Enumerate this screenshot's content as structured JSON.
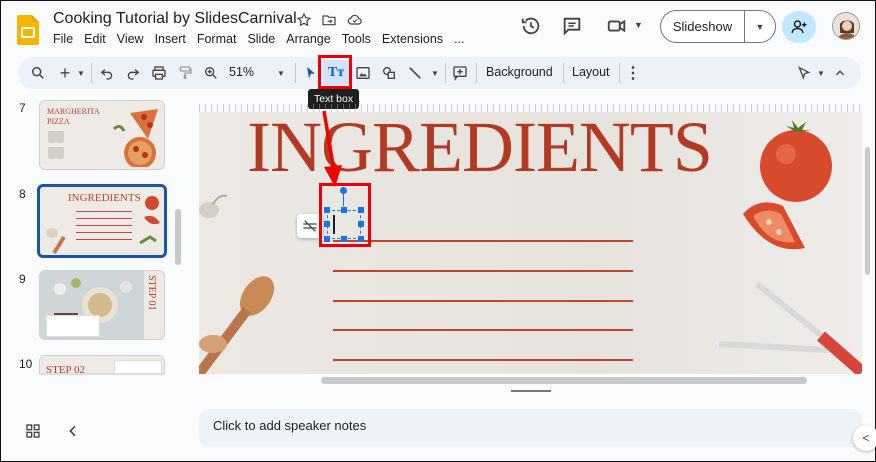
{
  "app": {
    "title": "Cooking Tutorial by SlidesCarnival",
    "menu": [
      "File",
      "Edit",
      "View",
      "Insert",
      "Format",
      "Slide",
      "Arrange",
      "Tools",
      "Extensions",
      "..."
    ]
  },
  "header": {
    "slideshow_label": "Slideshow"
  },
  "toolbar": {
    "zoom": "51%",
    "background_label": "Background",
    "layout_label": "Layout",
    "tooltip": "Text box"
  },
  "filmstrip": {
    "slides": [
      {
        "number": "7",
        "title": "MARGHERITA PIZZA"
      },
      {
        "number": "8",
        "title": "INGREDIENTS"
      },
      {
        "number": "9",
        "title": "STEP 01"
      },
      {
        "number": "10",
        "title": "STEP 02"
      }
    ]
  },
  "slide": {
    "title": "INGREDIENTS"
  },
  "notes": {
    "placeholder": "Click to add speaker notes"
  },
  "colors": {
    "accent": "#1a73e8",
    "annotation": "#e00000",
    "slide_title": "#b23a22"
  }
}
